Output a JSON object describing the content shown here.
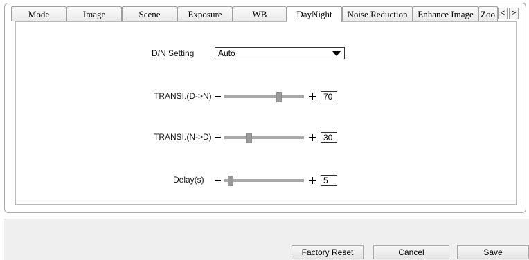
{
  "tabs": {
    "items": [
      "Mode",
      "Image",
      "Scene",
      "Exposure",
      "WB",
      "DayNight",
      "Noise Reduction",
      "Enhance Image",
      "Zoo"
    ],
    "active": "DayNight",
    "prev_label": "<",
    "next_label": ">"
  },
  "dn_setting": {
    "label": "D/N Setting",
    "selected": "Auto"
  },
  "sliders": [
    {
      "label": "TRANSI.(D->N)",
      "value": "70",
      "level": 0.7
    },
    {
      "label": "TRANSI.(N->D)",
      "value": "30",
      "level": 0.3
    },
    {
      "label": "Delay(s)",
      "value": "5",
      "level": 0.05
    }
  ],
  "buttons": {
    "factory_reset": "Factory Reset",
    "cancel": "Cancel",
    "save": "Save"
  }
}
